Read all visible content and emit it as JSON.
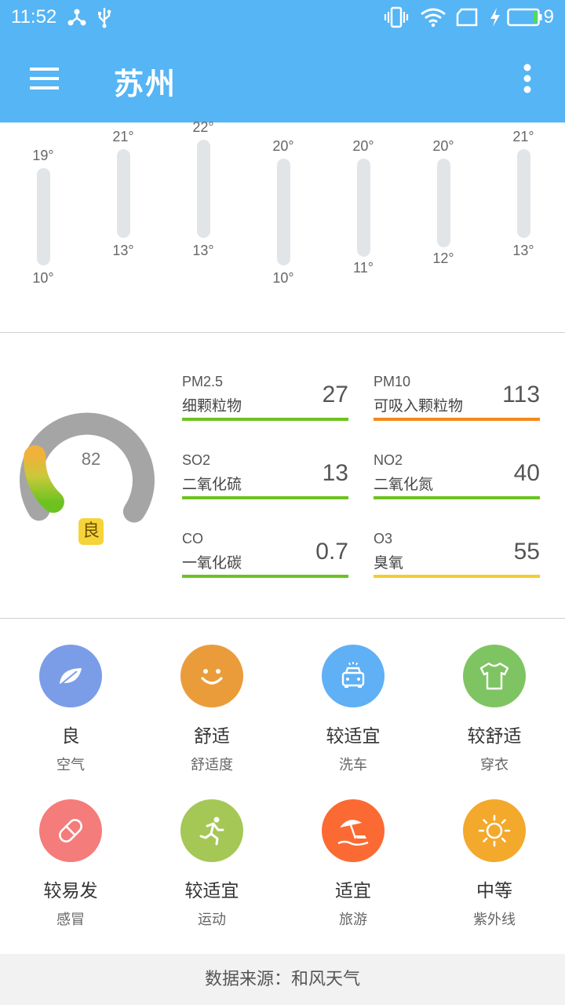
{
  "status_bar": {
    "time": "11:52",
    "battery_level": "9",
    "icons": [
      "share-icon",
      "usb-icon",
      "vibrate-icon",
      "wifi-icon",
      "sim-icon",
      "charging-icon",
      "battery-icon"
    ]
  },
  "app_bar": {
    "title": "苏州",
    "background": "#55b5f5"
  },
  "forecast": {
    "days": [
      {
        "high": "19°",
        "low": "10°"
      },
      {
        "high": "21°",
        "low": "13°"
      },
      {
        "high": "22°",
        "low": "13°"
      },
      {
        "high": "20°",
        "low": "10°"
      },
      {
        "high": "20°",
        "low": "11°"
      },
      {
        "high": "20°",
        "low": "12°"
      },
      {
        "high": "21°",
        "low": "13°"
      }
    ]
  },
  "aqi": {
    "value": "82",
    "level": "良",
    "level_color": "#f7d33a",
    "pollutants": [
      {
        "code": "PM2.5",
        "name": "细颗粒物",
        "value": "27",
        "color": "#6cc320"
      },
      {
        "code": "PM10",
        "name": "可吸入颗粒物",
        "value": "113",
        "color": "#f48a1a"
      },
      {
        "code": "SO2",
        "name": "二氧化硫",
        "value": "13",
        "color": "#6cc320"
      },
      {
        "code": "NO2",
        "name": "二氧化氮",
        "value": "40",
        "color": "#6cc320"
      },
      {
        "code": "CO",
        "name": "一氧化碳",
        "value": "0.7",
        "color": "#6cc320"
      },
      {
        "code": "O3",
        "name": "臭氧",
        "value": "55",
        "color": "#f3cd2e"
      }
    ]
  },
  "life_index": [
    {
      "status": "良",
      "type": "空气",
      "icon": "leaf-icon",
      "color": "#7b9de8"
    },
    {
      "status": "舒适",
      "type": "舒适度",
      "icon": "smile-icon",
      "color": "#eb9c3a"
    },
    {
      "status": "较适宜",
      "type": "洗车",
      "icon": "car-icon",
      "color": "#5fb0f5"
    },
    {
      "status": "较舒适",
      "type": "穿衣",
      "icon": "shirt-icon",
      "color": "#7fc463"
    },
    {
      "status": "较易发",
      "type": "感冒",
      "icon": "pill-icon",
      "color": "#f47c7b"
    },
    {
      "status": "较适宜",
      "type": "运动",
      "icon": "runner-icon",
      "color": "#a5c756"
    },
    {
      "status": "适宜",
      "type": "旅游",
      "icon": "beach-icon",
      "color": "#fb6a33"
    },
    {
      "status": "中等",
      "type": "紫外线",
      "icon": "sun-icon",
      "color": "#f2a92c"
    }
  ],
  "footer": {
    "text": "数据来源：和风天气"
  }
}
